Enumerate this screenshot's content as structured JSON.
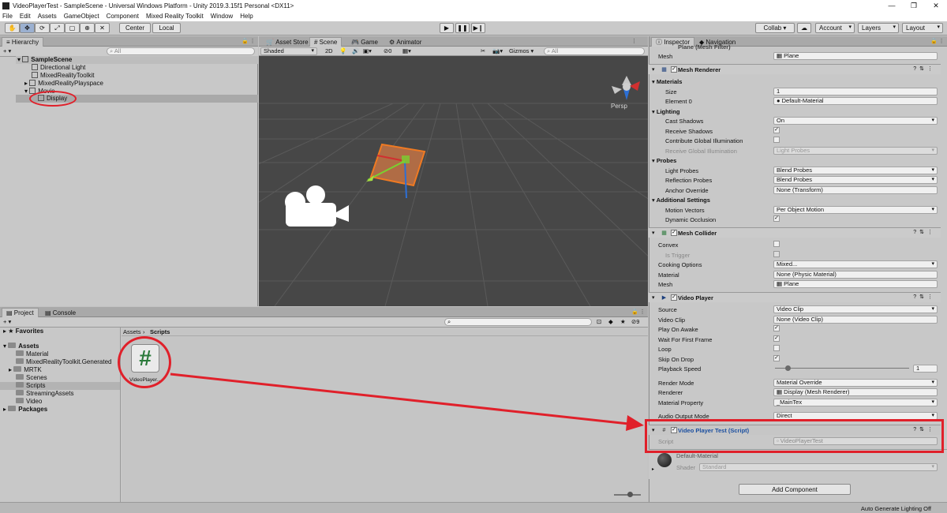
{
  "window": {
    "title": "VideoPlayerTest - SampleScene - Universal Windows Platform - Unity 2019.3.15f1 Personal <DX11>",
    "controls": [
      "—",
      "❐",
      "✕"
    ]
  },
  "menu": [
    "File",
    "Edit",
    "Assets",
    "GameObject",
    "Component",
    "Mixed Reality Toolkit",
    "Window",
    "Help"
  ],
  "toolbar": {
    "pivot": "Center",
    "space": "Local",
    "collab": "Collab ▾",
    "account": "Account",
    "layers": "Layers",
    "layout": "Layout"
  },
  "hierarchy": {
    "tab": "Hierarchy",
    "search_placeholder": "All",
    "add": "+ ▾",
    "items": [
      {
        "label": "SampleScene"
      },
      {
        "label": "Directional Light"
      },
      {
        "label": "MixedRealityToolkit"
      },
      {
        "label": "MixedRealityPlayspace"
      },
      {
        "label": "Movie"
      },
      {
        "label": "Display"
      }
    ]
  },
  "scene": {
    "tabs": [
      "Asset Store",
      "Scene",
      "Game",
      "Animator"
    ],
    "shading": "Shaded",
    "mode2d": "2D",
    "hidden_count": "0",
    "gizmos": "Gizmos",
    "search_placeholder": "All",
    "persp": "Persp"
  },
  "project": {
    "tabs": [
      "Project",
      "Console"
    ],
    "add": "+ ▾",
    "hidden_count": "9",
    "breadcrumb": [
      "Assets",
      "Scripts"
    ],
    "favorites": "Favorites",
    "assets_root": "Assets",
    "folders": [
      "Material",
      "MixedRealityToolkit.Generated",
      "MRTK",
      "Scenes",
      "Scripts",
      "StreamingAssets",
      "Video"
    ],
    "packages": "Packages",
    "file": {
      "name": "VideoPlayer...",
      "glyph": "#"
    }
  },
  "inspector": {
    "tabs": [
      "Inspector",
      "Navigation"
    ],
    "mesh_filter": {
      "title": "Plane (Mesh Filter)",
      "mesh_label": "Mesh",
      "mesh_value": "Plane"
    },
    "mesh_renderer": {
      "title": "Mesh Renderer",
      "materials": "Materials",
      "size_label": "Size",
      "size_value": "1",
      "element0_label": "Element 0",
      "element0_value": "Default-Material",
      "lighting": "Lighting",
      "cast_shadows_label": "Cast Shadows",
      "cast_shadows_value": "On",
      "receive_shadows_label": "Receive Shadows",
      "contribute_gi_label": "Contribute Global Illumination",
      "receive_gi_label": "Receive Global Illumination",
      "receive_gi_value": "Light Probes",
      "probes": "Probes",
      "light_probes_label": "Light Probes",
      "light_probes_value": "Blend Probes",
      "reflection_probes_label": "Reflection Probes",
      "reflection_probes_value": "Blend Probes",
      "anchor_override_label": "Anchor Override",
      "anchor_override_value": "None (Transform)",
      "additional": "Additional Settings",
      "motion_vectors_label": "Motion Vectors",
      "motion_vectors_value": "Per Object Motion",
      "dynamic_occlusion_label": "Dynamic Occlusion"
    },
    "mesh_collider": {
      "title": "Mesh Collider",
      "convex_label": "Convex",
      "is_trigger_label": "Is Trigger",
      "cooking_label": "Cooking Options",
      "cooking_value": "Mixed...",
      "material_label": "Material",
      "material_value": "None (Physic Material)",
      "mesh_label": "Mesh",
      "mesh_value": "Plane"
    },
    "video_player": {
      "title": "Video Player",
      "source_label": "Source",
      "source_value": "Video Clip",
      "clip_label": "Video Clip",
      "clip_value": "None (Video Clip)",
      "play_on_awake_label": "Play On Awake",
      "wait_first_frame_label": "Wait For First Frame",
      "loop_label": "Loop",
      "skip_on_drop_label": "Skip On Drop",
      "playback_speed_label": "Playback Speed",
      "playback_speed_value": "1",
      "render_mode_label": "Render Mode",
      "render_mode_value": "Material Override",
      "renderer_label": "Renderer",
      "renderer_value": "Display (Mesh Renderer)",
      "material_property_label": "Material Property",
      "material_property_value": "_MainTex",
      "audio_output_label": "Audio Output Mode",
      "audio_output_value": "Direct"
    },
    "script_comp": {
      "title": "Video Player Test (Script)",
      "script_label": "Script",
      "script_value": "VideoPlayerTest"
    },
    "material": {
      "name": "Default-Material",
      "shader_label": "Shader",
      "shader_value": "Standard"
    },
    "add_component": "Add Component"
  },
  "status": {
    "text": "Auto Generate Lighting Off"
  },
  "colors": {
    "annotation": "#e0202a",
    "script_title": "#1b4fa0"
  }
}
